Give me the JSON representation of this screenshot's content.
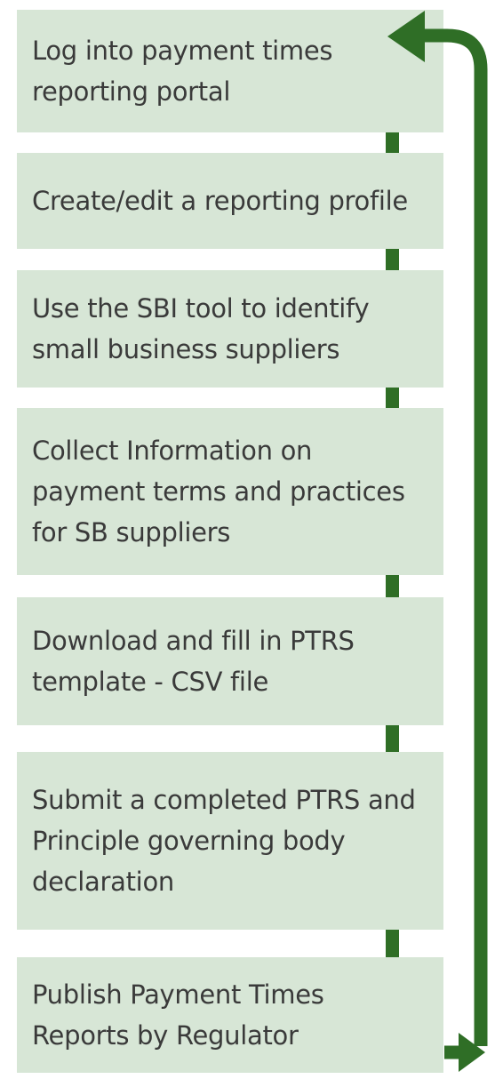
{
  "flow": {
    "steps": [
      {
        "label": "Log into payment times\nreporting portal"
      },
      {
        "label": "Create/edit a reporting profile"
      },
      {
        "label": "Use the SBI tool to identify\nsmall business suppliers"
      },
      {
        "label": "Collect Information on\npayment terms and practices\nfor SB suppliers"
      },
      {
        "label": "Download and fill in PTRS\ntemplate - CSV file"
      },
      {
        "label": "Submit a completed PTRS and\nPrinciple governing body\ndeclaration"
      },
      {
        "label": "Publish Payment Times\nReports by Regulator"
      }
    ]
  },
  "colors": {
    "box_fill": "#d7e6d6",
    "text": "#3a3a3a",
    "arrow": "#2f6e26"
  }
}
